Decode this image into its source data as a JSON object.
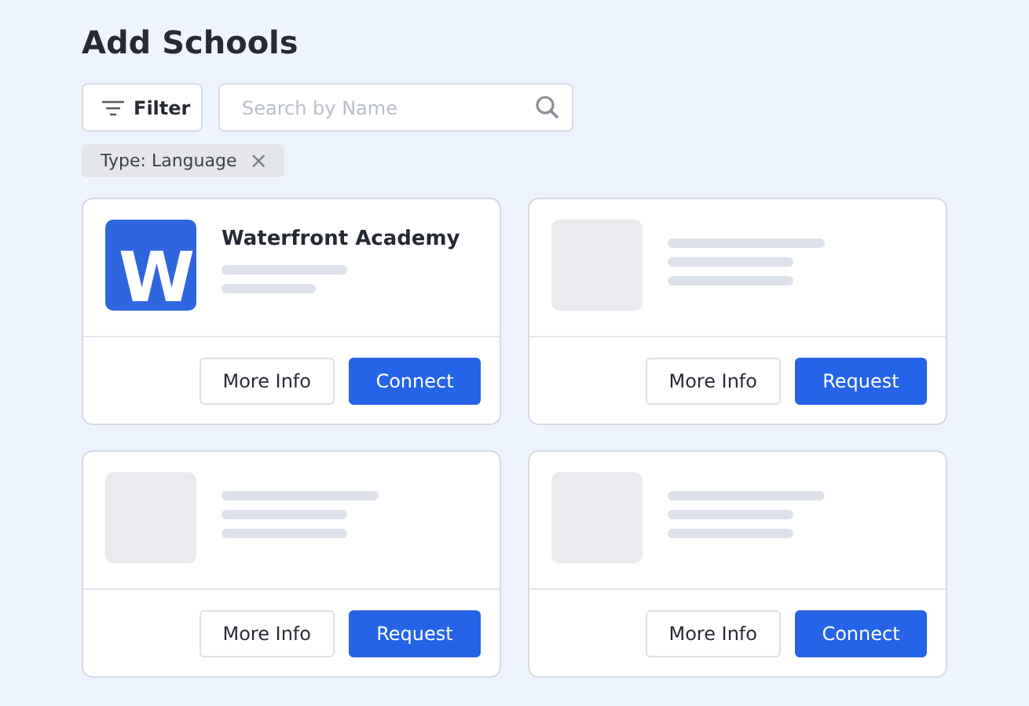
{
  "title": "Add Schools",
  "toolbar": {
    "filter_label": "Filter",
    "search": {
      "placeholder": "Search by Name"
    }
  },
  "chips": [
    {
      "label": "Type: Language",
      "close": "×"
    }
  ],
  "cards": [
    {
      "kind": "loaded",
      "logo_letter": "W",
      "name": "Waterfront Academy",
      "buttons": [
        {
          "label": "More Info",
          "primary": false
        },
        {
          "label": "Connect",
          "primary": true
        }
      ]
    },
    {
      "kind": "placeholder",
      "buttons": [
        {
          "label": "More Info",
          "primary": false
        },
        {
          "label": "Request",
          "primary": true
        }
      ]
    },
    {
      "kind": "placeholder",
      "buttons": [
        {
          "label": "More Info",
          "primary": false
        },
        {
          "label": "Request",
          "primary": true
        }
      ]
    },
    {
      "kind": "placeholder",
      "buttons": [
        {
          "label": "More Info",
          "primary": false
        },
        {
          "label": "Connect",
          "primary": true
        }
      ]
    }
  ]
}
